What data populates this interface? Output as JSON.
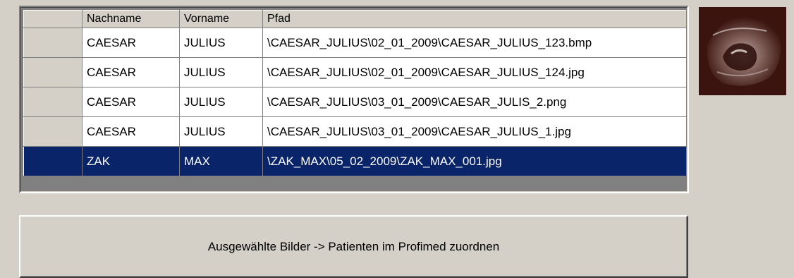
{
  "grid": {
    "columns": [
      "Nachname",
      "Vorname",
      "Pfad"
    ],
    "rows": [
      {
        "nachname": "CAESAR",
        "vorname": "JULIUS",
        "pfad": "\\CAESAR_JULIUS\\02_01_2009\\CAESAR_JULIUS_123.bmp"
      },
      {
        "nachname": "CAESAR",
        "vorname": "JULIUS",
        "pfad": "\\CAESAR_JULIUS\\02_01_2009\\CAESAR_JULIUS_124.jpg"
      },
      {
        "nachname": "CAESAR",
        "vorname": "JULIUS",
        "pfad": "\\CAESAR_JULIUS\\03_01_2009\\CAESAR_JULIS_2.png"
      },
      {
        "nachname": "CAESAR",
        "vorname": "JULIUS",
        "pfad": "\\CAESAR_JULIUS\\03_01_2009\\CAESAR_JULIUS_1.jpg"
      },
      {
        "nachname": "ZAK",
        "vorname": "MAX",
        "pfad": "\\ZAK_MAX\\05_02_2009\\ZAK_MAX_001.jpg"
      }
    ],
    "selected_row": 4
  },
  "preview": {
    "icon": "ultrasound-preview-image"
  },
  "assign_button": {
    "label": "Ausgewählte Bilder -> Patienten im Profimed zuordnen"
  },
  "colors": {
    "selection": "#0a246a",
    "face": "#d4d0c8",
    "preview_bg": "#3b1410"
  }
}
